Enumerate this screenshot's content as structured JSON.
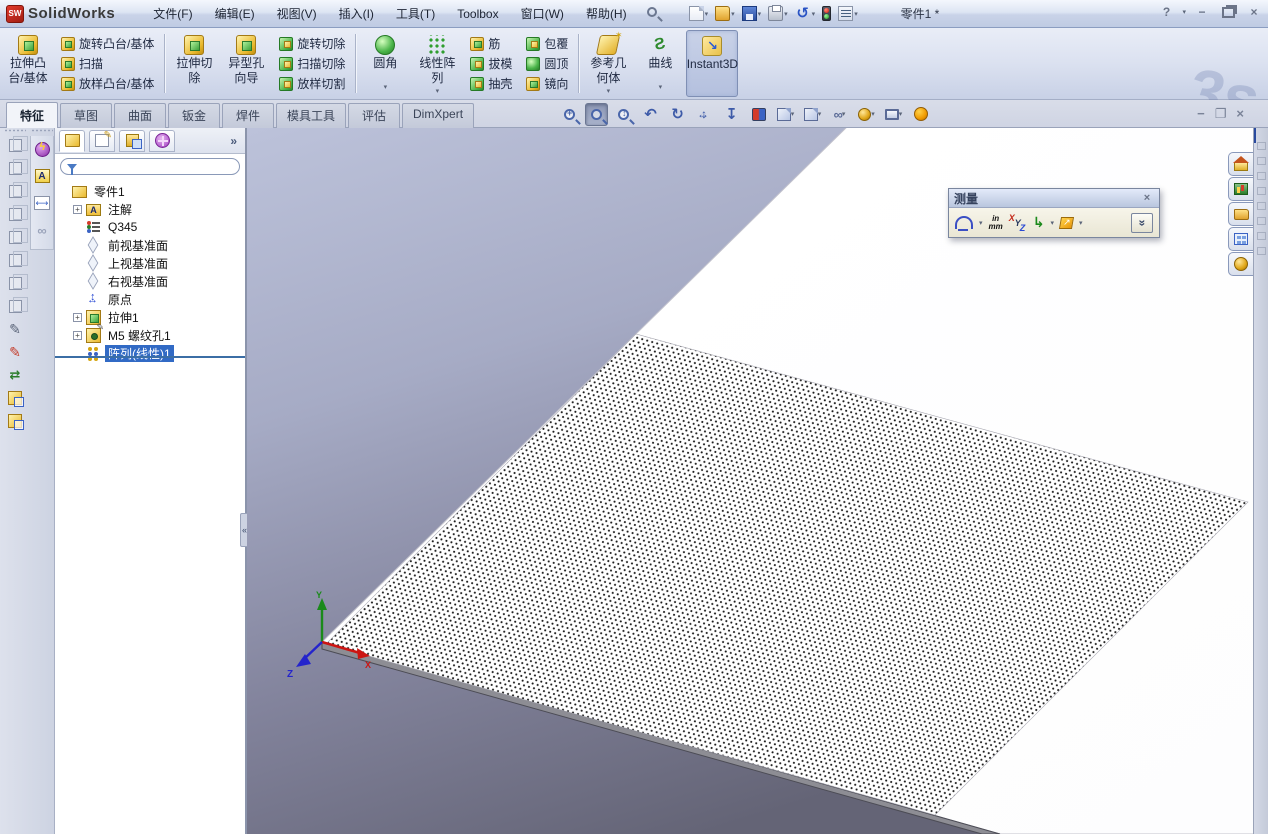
{
  "titlebar": {
    "brand": "SolidWorks",
    "badge": "SW",
    "menus": [
      "文件(F)",
      "编辑(E)",
      "视图(V)",
      "插入(I)",
      "工具(T)",
      "Toolbox",
      "窗口(W)",
      "帮助(H)"
    ],
    "document_title": "零件1 *",
    "help_label": "?"
  },
  "ribbon": {
    "extruded_boss_l1": "拉伸凸",
    "extruded_boss_l2": "台/基体",
    "revolved_boss": "旋转凸台/基体",
    "sweep": "扫描",
    "lofted_boss": "放样凸台/基体",
    "extruded_cut_l1": "拉伸切",
    "extruded_cut_l2": "除",
    "hole_wizard_l1": "异型孔",
    "hole_wizard_l2": "向导",
    "revolved_cut": "旋转切除",
    "swept_cut": "扫描切除",
    "lofted_cut": "放样切割",
    "fillet": "圆角",
    "linear_pattern_l1": "线性阵",
    "linear_pattern_l2": "列",
    "rib": "筋",
    "draft": "拔模",
    "shell": "抽壳",
    "wrap": "包覆",
    "dome": "圆顶",
    "mirror": "镜向",
    "reference_geometry_l1": "参考几",
    "reference_geometry_l2": "何体",
    "curves": "曲线",
    "instant3d": "Instant3D"
  },
  "tabs": {
    "items": [
      "特征",
      "草图",
      "曲面",
      "钣金",
      "焊件",
      "模具工具",
      "评估",
      "DimXpert"
    ],
    "active": "特征"
  },
  "feature_tree": {
    "items": [
      {
        "label": "零件1"
      },
      {
        "label": "注解"
      },
      {
        "label": "Q345"
      },
      {
        "label": "前视基准面"
      },
      {
        "label": "上视基准面"
      },
      {
        "label": "右视基准面"
      },
      {
        "label": "原点"
      },
      {
        "label": "拉伸1"
      },
      {
        "label": "M5 螺纹孔1"
      },
      {
        "label": "阵列(线性)1"
      }
    ],
    "selected": "阵列(线性)1"
  },
  "measure_dialog": {
    "title": "测量",
    "unit_top": "in",
    "unit_bottom": "mm",
    "x": "X",
    "y": "Y",
    "z": "Z"
  },
  "colors": {
    "selection_blue": "#316ac5",
    "ribbon_bg": "#dbe1f0",
    "viewport_top": "#bcc2da",
    "viewport_bottom": "#646477",
    "plate_white": "#fdfdfe",
    "hole_dot": "#1c1c1c"
  }
}
